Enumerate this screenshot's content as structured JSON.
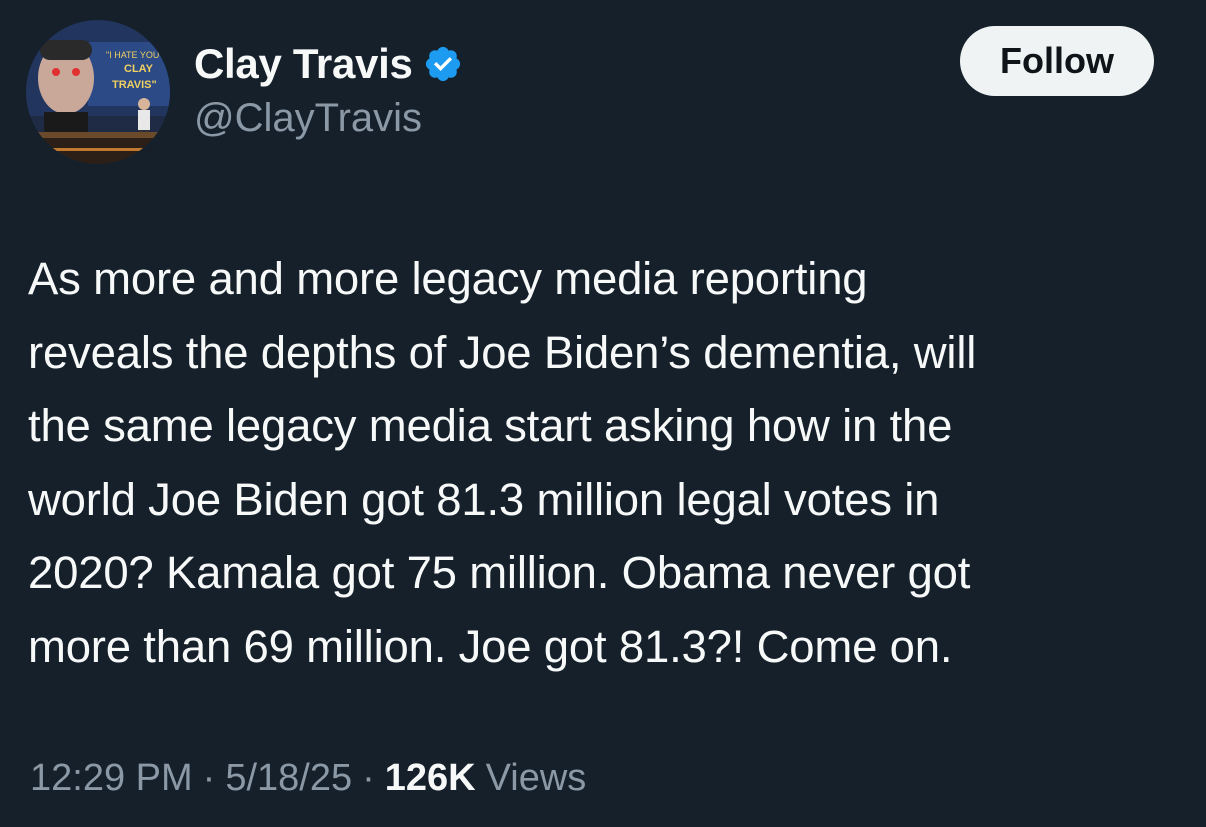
{
  "author": {
    "display_name": "Clay Travis",
    "handle": "@ClayTravis",
    "verified_icon": "verified-badge-icon",
    "avatar_sign_text": [
      "\"I HATE YOU",
      "CLAY",
      "TRAVIS\""
    ]
  },
  "actions": {
    "follow_label": "Follow"
  },
  "tweet": {
    "text": "As more and more legacy media reporting\nreveals the depths of Joe Biden’s dementia, will\nthe same legacy media start asking how in the\nworld Joe Biden got 81.3 million legal votes in\n2020? Kamala got 75 million. Obama never got\nmore than 69 million. Joe got 81.3?! Come on."
  },
  "meta": {
    "time": "12:29 PM",
    "separator": "·",
    "date": "5/18/25",
    "views_count": "126K",
    "views_label": "Views"
  },
  "colors": {
    "background": "#15202b",
    "text_primary": "#f7f9f9",
    "text_secondary": "#8b98a5",
    "verified_blue": "#1d9bf0",
    "button_bg": "#eff3f4"
  }
}
